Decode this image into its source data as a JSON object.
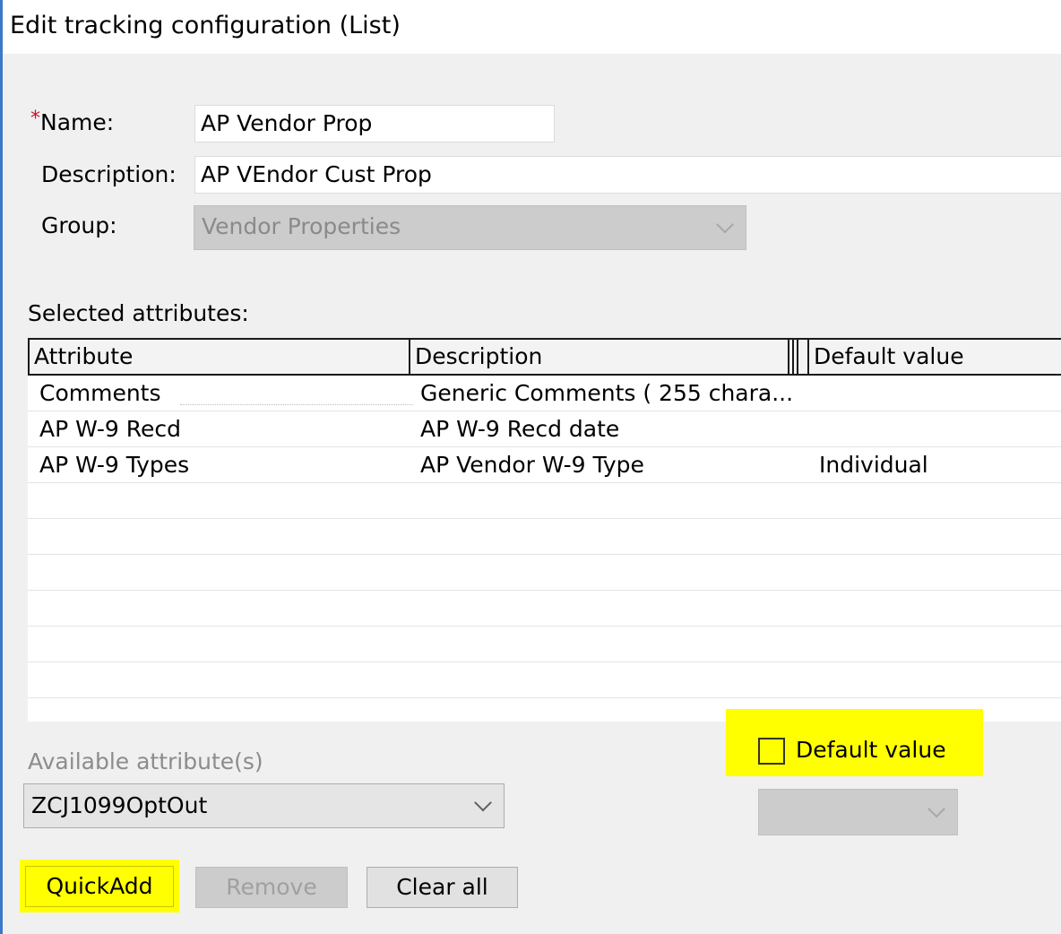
{
  "window": {
    "title": "Edit tracking configuration (List)"
  },
  "form": {
    "required_marker": "*",
    "name_label": "Name:",
    "name_value": "AP Vendor Prop",
    "description_label": "Description:",
    "description_value": "AP VEndor Cust  Prop",
    "group_label": "Group:",
    "group_value": "Vendor Properties"
  },
  "attributes": {
    "section_label": "Selected attributes:",
    "columns": [
      "Attribute",
      "Description",
      "Default value"
    ],
    "rows": [
      {
        "attribute": "Comments",
        "description": "Generic Comments ( 255 chara...",
        "default": ""
      },
      {
        "attribute": "AP W-9 Recd",
        "description": "AP W-9 Recd date",
        "default": ""
      },
      {
        "attribute": "AP W-9 Types",
        "description": "AP Vendor W-9 Type",
        "default": "Individual"
      }
    ]
  },
  "available": {
    "label": "Available attribute(s)",
    "selected": "ZCJ1099OptOut"
  },
  "default_value": {
    "checkbox_label": "Default value",
    "checked": false,
    "dropdown_value": ""
  },
  "buttons": {
    "quickadd": "QuickAdd",
    "remove": "Remove",
    "clear_all": "Clear all"
  },
  "colors": {
    "highlight": "#ffff00",
    "required": "#c8102e",
    "window_accent": "#3c78c8"
  }
}
